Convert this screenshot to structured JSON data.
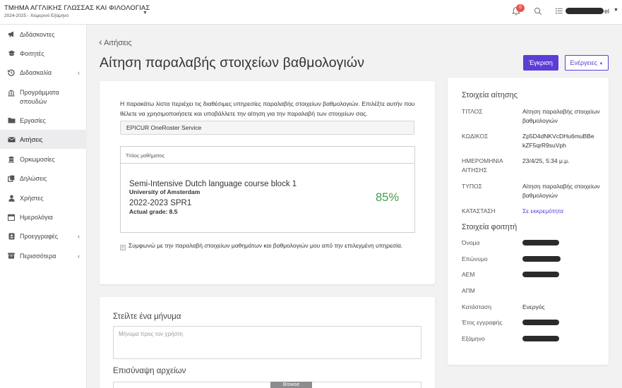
{
  "header": {
    "department": "ΤΜΗΜΑ ΑΓΓΛΙΚΗΣ ΓΛΩΣΣΑΣ ΚΑΙ ΦΙΛΟΛΟΓΙΑΣ",
    "term": "2024-2025 - Χειμερινό Εξάμηνο",
    "notifications_count": "0",
    "language": "el"
  },
  "sidebar": {
    "items": [
      {
        "label": "Διδάσκοντες",
        "icon": "megaphone-icon"
      },
      {
        "label": "Φοιτητές",
        "icon": "graduation-cap-icon"
      },
      {
        "label": "Διδασκαλία",
        "icon": "history-icon"
      },
      {
        "label": "Προγράμματα σπουδών",
        "icon": "institution-icon"
      },
      {
        "label": "Εργασίες",
        "icon": "folder-icon"
      },
      {
        "label": "Αιτήσεις",
        "icon": "envelope-icon"
      },
      {
        "label": "Ορκωμοσίες",
        "icon": "graduation-ceremony-icon"
      },
      {
        "label": "Δηλώσεις",
        "icon": "copy-icon"
      },
      {
        "label": "Χρήστες",
        "icon": "user-icon"
      },
      {
        "label": "Ημερολόγια",
        "icon": "calendar-icon"
      },
      {
        "label": "Προεγγραφές",
        "icon": "id-card-icon"
      },
      {
        "label": "Περισσότερα",
        "icon": "archive-icon"
      }
    ]
  },
  "page": {
    "back_label": "Αιτήσεις",
    "title": "Αίτηση παραλαβής στοιχείων βαθμολογιών",
    "approve_label": "Έγκριση",
    "actions_label": "Ενέργειες"
  },
  "request": {
    "intro": "Η παρακάτω λίστα περιέχει τις διαθέσιμες υπηρεσίες παραλαβής στοιχείων βαθμολογιών. Επιλέξτε αυτήν που θέλετε να χρησιμοποιήσετε και υποβάλλετε την αίτηση για την παραλαβή των στοιχείων σας.",
    "service": "EPICUR OneRoster Service",
    "course_header": "Τίτλος μαθήματος",
    "course_name": "Semi-Intensive Dutch language course block 1",
    "university": "University of Amsterdam",
    "course_term": "2022-2023 SPR1",
    "actual_grade": "Actual grade: 8.5",
    "percent": "85%",
    "agreement": "Συμφωνώ με την παραλαβή στοιχείων μαθημάτων και βαθμολογιών μου από την επιλεγμένη υπηρεσία."
  },
  "message": {
    "title": "Στείλτε ένα μήνυμα",
    "placeholder": "Μήνυμα προς τον χρήστη",
    "attach_title": "Επισύναψη αρχείων",
    "browse_label": "Browse"
  },
  "info": {
    "request_title": "Στοιχεία αίτησης",
    "title_key": "ΤΙΤΛΟΣ",
    "title_value": "Αίτηση παραλαβής στοιχείων βαθμολογιών",
    "code_key": "ΚΩΔΙΚΟΣ",
    "code_value": "Zp5D4dNKVcDHu6muBBekZF5qrR9suVph",
    "date_key": "ΗΜΕΡΟΜΗΝΙΑ ΑΙΤΗΣΗΣ",
    "date_value": "23/4/25, 5:34 μ.μ.",
    "type_key": "ΤΥΠΟΣ",
    "type_value": "Αίτηση παραλαβής στοιχείων βαθμολογιών",
    "status_key": "ΚΑΤΑΣΤΑΣΗ",
    "status_value": "Σε εκκρεμότητα",
    "student_title": "Στοιχεία φοιτητή",
    "first_name_key": "Όνομα",
    "last_name_key": "Επώνυμο",
    "aem_key": "ΑΕΜ",
    "apm_key": "ΑΠΜ",
    "state_key": "Κατάσταση",
    "state_value": "Ενεργός",
    "enroll_year_key": "Έτος εγγραφής",
    "semester_key": "Εξάμηνο"
  },
  "colors": {
    "primary": "#5b3ed6",
    "grade_green": "#3fa14a",
    "badge_red": "#e8554e"
  }
}
